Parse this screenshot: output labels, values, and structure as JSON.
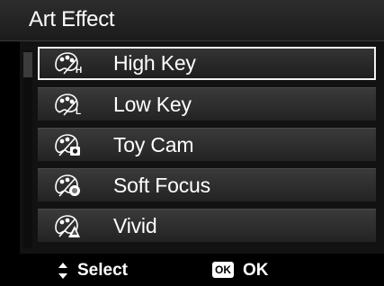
{
  "header": {
    "title": "Art Effect"
  },
  "menu": {
    "items": [
      {
        "label": "High Key",
        "icon": "high-key-icon",
        "badge": "H",
        "selected": true
      },
      {
        "label": "Low Key",
        "icon": "low-key-icon",
        "badge": "L",
        "selected": false
      },
      {
        "label": "Toy Cam",
        "icon": "toy-cam-icon",
        "badge": "",
        "selected": false
      },
      {
        "label": "Soft Focus",
        "icon": "soft-focus-icon",
        "badge": "",
        "selected": false
      },
      {
        "label": "Vivid",
        "icon": "vivid-icon",
        "badge": "",
        "selected": false
      }
    ]
  },
  "footer": {
    "select_label": "Select",
    "ok_icon_text": "OK",
    "ok_label": "OK"
  },
  "colors": {
    "background": "#000000",
    "text": "#ffffff",
    "selection_border": "#f2f2f2"
  }
}
